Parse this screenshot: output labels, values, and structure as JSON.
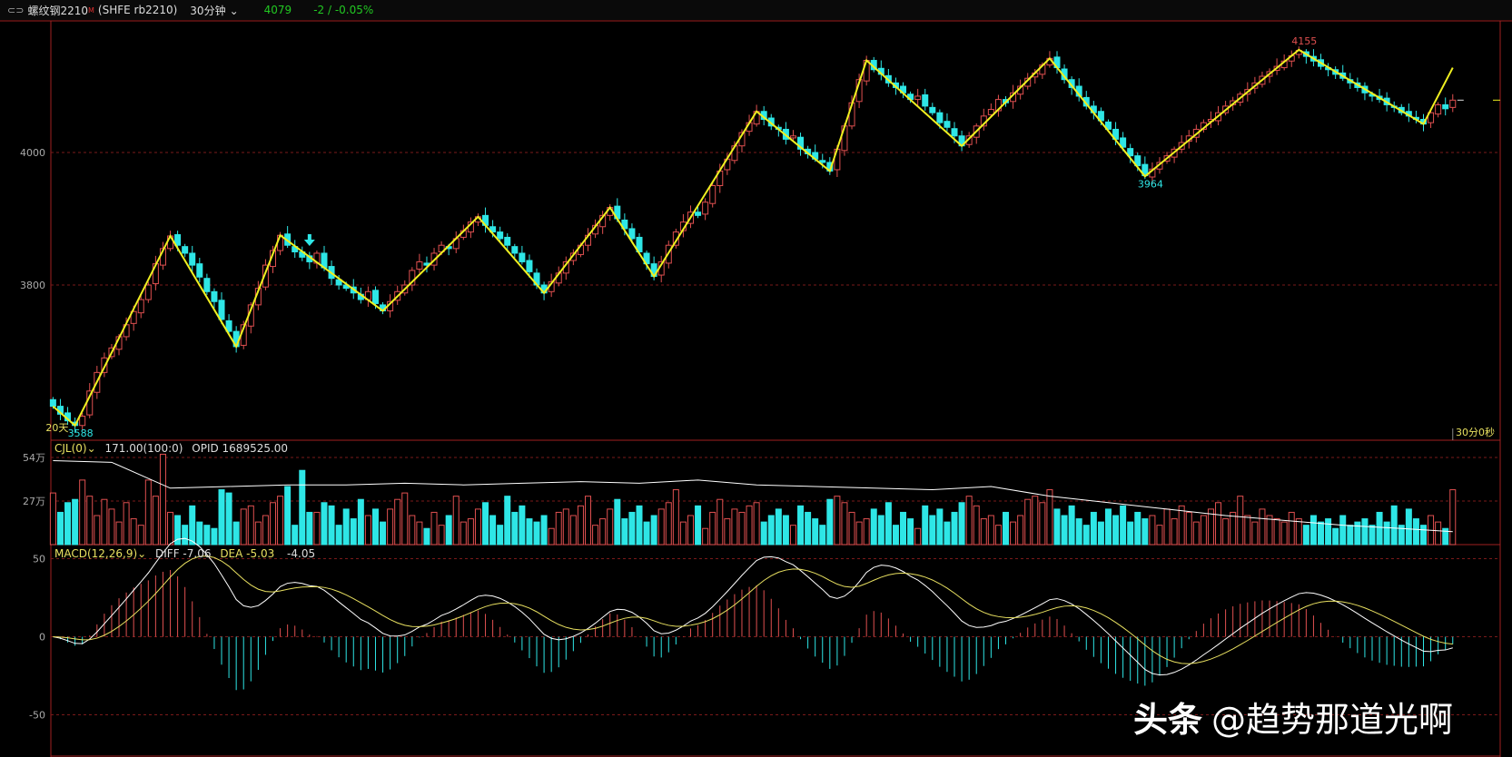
{
  "header": {
    "link_icon": "link-icon",
    "name": "螺纹钢2210",
    "main_flag": "M",
    "code": "(SHFE rb2210)",
    "period": "30分钟",
    "period_chevron": "chevron-down-icon",
    "last_price": "4079",
    "change": "-2 / -0.05%"
  },
  "colors": {
    "up": "#e05050",
    "down": "#2ee6e6",
    "zigzag": "#f0f020",
    "grid": "#7a1a1a",
    "border": "#a02020",
    "diff": "#ffffff",
    "dea": "#e8e060"
  },
  "price_axis": {
    "ticks": [
      "4000",
      "3800"
    ]
  },
  "countdown": "30分0秒",
  "volume_pane": {
    "title": "CJL(0)",
    "values": "171.00(100:0)",
    "opid": "OPID 1689525.00",
    "ticks": [
      "54万",
      "27万"
    ]
  },
  "macd_pane": {
    "title": "MACD(12,26,9)",
    "diff": "DIFF -7.06",
    "dea": "DEA -5.03",
    "macd": "-4.05",
    "ticks": [
      "50",
      "0",
      "-50"
    ]
  },
  "watermark": {
    "brand": "头条",
    "handle": "@趋势那道光啊"
  },
  "chart_data": {
    "type": "candlestick",
    "price_range": [
      3566,
      4197
    ],
    "close": [
      3617,
      3605,
      3595,
      3588,
      3602,
      3640,
      3668,
      3690,
      3705,
      3722,
      3740,
      3760,
      3778,
      3800,
      3832,
      3855,
      3874,
      3860,
      3848,
      3830,
      3812,
      3790,
      3775,
      3748,
      3730,
      3707,
      3740,
      3770,
      3795,
      3830,
      3852,
      3875,
      3860,
      3850,
      3842,
      3835,
      3848,
      3826,
      3810,
      3800,
      3795,
      3788,
      3778,
      3790,
      3772,
      3761,
      3775,
      3790,
      3800,
      3822,
      3835,
      3830,
      3848,
      3860,
      3855,
      3870,
      3882,
      3895,
      3903,
      3890,
      3880,
      3870,
      3860,
      3848,
      3835,
      3820,
      3800,
      3788,
      3805,
      3818,
      3835,
      3848,
      3860,
      3875,
      3890,
      3905,
      3917,
      3900,
      3885,
      3870,
      3850,
      3832,
      3813,
      3835,
      3860,
      3880,
      3895,
      3910,
      3905,
      3925,
      3950,
      3972,
      3990,
      4010,
      4030,
      4045,
      4062,
      4050,
      4040,
      4035,
      4020,
      4025,
      4005,
      3998,
      3990,
      3985,
      3972,
      4005,
      4040,
      4075,
      4110,
      4139,
      4125,
      4118,
      4105,
      4098,
      4090,
      4080,
      4085,
      4070,
      4060,
      4045,
      4038,
      4025,
      4010,
      4025,
      4040,
      4055,
      4065,
      4080,
      4075,
      4090,
      4100,
      4112,
      4120,
      4132,
      4142,
      4128,
      4110,
      4098,
      4085,
      4070,
      4060,
      4048,
      4035,
      4020,
      4008,
      3995,
      3980,
      3965,
      3975,
      3985,
      3995,
      4005,
      4015,
      4025,
      4035,
      4045,
      4050,
      4060,
      4070,
      4078,
      4088,
      4095,
      4105,
      4115,
      4122,
      4130,
      4138,
      4146,
      4154,
      4145,
      4138,
      4130,
      4125,
      4118,
      4112,
      4105,
      4098,
      4090,
      4085,
      4080,
      4072,
      4068,
      4060,
      4055,
      4050,
      4043,
      4060,
      4072,
      4066,
      4079
    ],
    "volume_wan": [
      32,
      20,
      26,
      28,
      40,
      30,
      18,
      28,
      22,
      14,
      26,
      16,
      12,
      40,
      30,
      56,
      20,
      18,
      12,
      24,
      14,
      12,
      10,
      34,
      32,
      14,
      22,
      24,
      14,
      18,
      26,
      30,
      36,
      12,
      46,
      20,
      20,
      26,
      24,
      12,
      22,
      16,
      28,
      18,
      22,
      14,
      22,
      28,
      32,
      18,
      14,
      10,
      20,
      12,
      18,
      30,
      14,
      16,
      22,
      26,
      18,
      12,
      30,
      20,
      24,
      16,
      14,
      18,
      10,
      20,
      22,
      18,
      24,
      30,
      12,
      16,
      22,
      28,
      16,
      20,
      24,
      14,
      18,
      22,
      26,
      34,
      14,
      18,
      24,
      10,
      20,
      28,
      16,
      22,
      20,
      24,
      26,
      14,
      18,
      22,
      18,
      12,
      24,
      20,
      16,
      12,
      28,
      30,
      26,
      20,
      14,
      16,
      22,
      18,
      26,
      12,
      20,
      16,
      10,
      24,
      18,
      22,
      14,
      20,
      26,
      30,
      24,
      16,
      18,
      12,
      20,
      14,
      18,
      28,
      30,
      26,
      34,
      22,
      18,
      24,
      16,
      12,
      20,
      14,
      22,
      18,
      24,
      14,
      20,
      16,
      18,
      12,
      22,
      16,
      24,
      20,
      14,
      18,
      22,
      26,
      16,
      20,
      30,
      18,
      14,
      22,
      18,
      16,
      14,
      20,
      16,
      12,
      18,
      14,
      16,
      10,
      18,
      12,
      14,
      16,
      12,
      20,
      14,
      24,
      12,
      22,
      16,
      12,
      18,
      14,
      10,
      34
    ],
    "opid_line": [
      52,
      51,
      35,
      36,
      37,
      37,
      38,
      37,
      38,
      39,
      38,
      40,
      37,
      36,
      35,
      34,
      36,
      30,
      26,
      22,
      18,
      15,
      12,
      10,
      8
    ],
    "zigzag": [
      [
        0,
        3617
      ],
      [
        3,
        3588
      ],
      [
        16,
        3874
      ],
      [
        25,
        3707
      ],
      [
        31,
        3875
      ],
      [
        45,
        3761
      ],
      [
        58,
        3903
      ],
      [
        67,
        3788
      ],
      [
        76,
        3917
      ],
      [
        82,
        3813
      ],
      [
        96,
        4062
      ],
      [
        106,
        3972
      ],
      [
        111,
        4139
      ],
      [
        124,
        4010
      ],
      [
        136,
        4142
      ],
      [
        149,
        3964
      ],
      [
        170,
        4155
      ],
      [
        187,
        4043
      ],
      [
        191,
        4128
      ]
    ],
    "annotations": [
      {
        "i": 3,
        "p": 3588,
        "text": "3588",
        "color": "#2ee6e6"
      },
      {
        "i": 0,
        "p": 3596,
        "text": "20天",
        "color": "#e8e060"
      },
      {
        "i": 149,
        "p": 3964,
        "text": "3964",
        "color": "#2ee6e6"
      },
      {
        "i": 170,
        "p": 4155,
        "text": "4155",
        "color": "#e05050"
      }
    ],
    "signal_arrow": {
      "i": 35,
      "direction": "down"
    },
    "macd_range": [
      -77,
      59
    ]
  }
}
